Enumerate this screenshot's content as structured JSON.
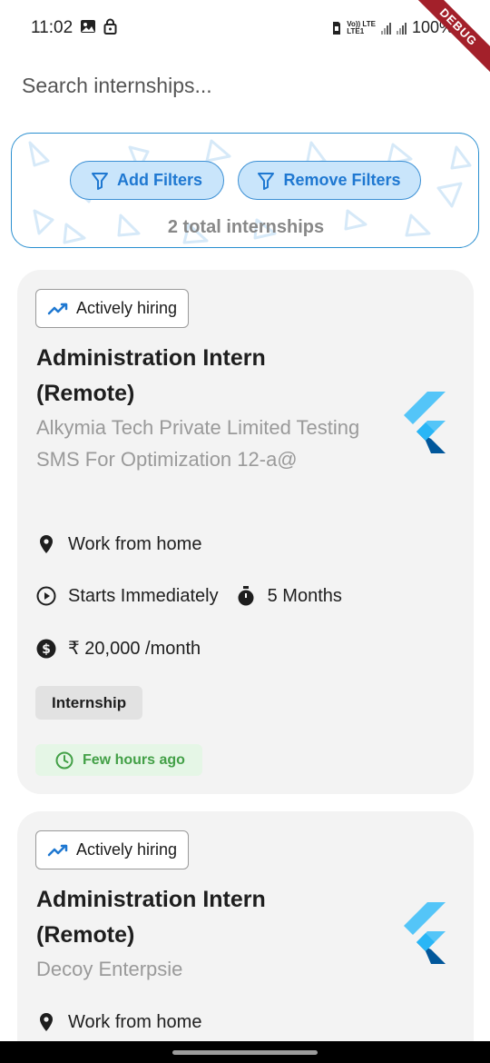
{
  "status_bar": {
    "time": "11:02",
    "network_label_top": "Vo)) LTE",
    "network_label_bottom": "LTE1",
    "battery": "100%",
    "debug_label": "DEBUG"
  },
  "search": {
    "placeholder": "Search internships...",
    "value": ""
  },
  "filters": {
    "add_label": "Add Filters",
    "remove_label": "Remove Filters",
    "total_text": "2 total internships",
    "accent_color": "#2a8fd0"
  },
  "listings": [
    {
      "badge": "Actively hiring",
      "title": "Administration Intern (Remote)",
      "company": "Alkymia Tech Private Limited Testing SMS For Optimization 12-a@",
      "location": "Work from home",
      "start": "Starts Immediately",
      "duration": "5 Months",
      "stipend": "₹ 20,000 /month",
      "type": "Internship",
      "posted": "Few hours ago",
      "logo_icon": "flutter-logo-icon"
    },
    {
      "badge": "Actively hiring",
      "title": "Administration Intern (Remote)",
      "company": "Decoy Enterpsie",
      "location": "Work from home",
      "logo_icon": "flutter-logo-icon"
    }
  ],
  "colors": {
    "posted_green": "#43a047",
    "chip_blue": "#c9e5fb",
    "card_bg": "#f3f3f3"
  }
}
